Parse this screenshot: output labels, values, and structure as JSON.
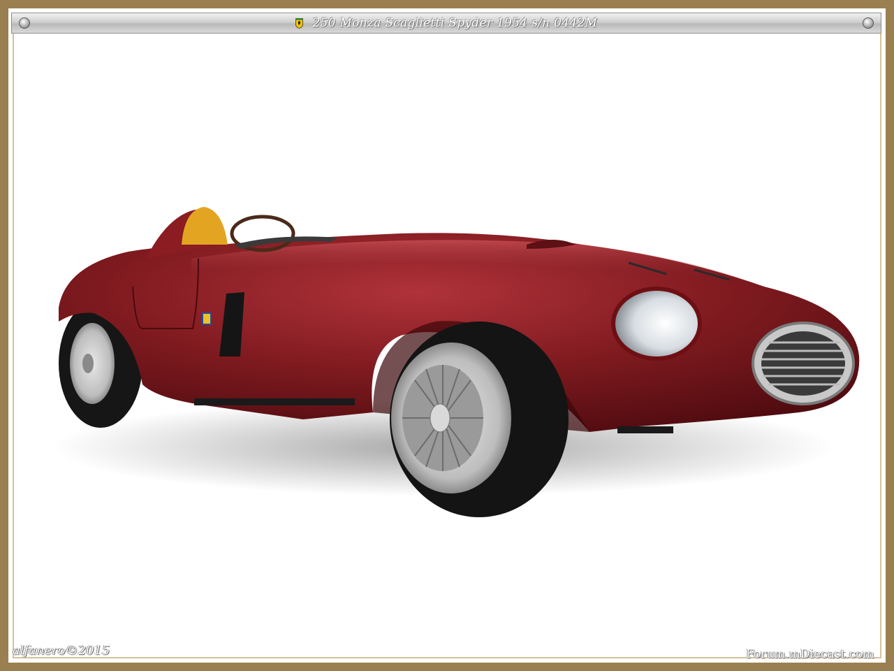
{
  "header": {
    "title": "250 Monza Scaglietti Spyder 1954  s/n 0442M",
    "badge_icon": "prancing-horse-badge-icon"
  },
  "watermarks": {
    "author": "alfanero©2015",
    "site": "Forum.mDiecast.com"
  },
  "photo": {
    "subject": "red-vintage-sports-car",
    "colors": {
      "body": "#7a1418",
      "seat": "#e0a020",
      "frame": "#9a8050",
      "background": "#ffffff"
    }
  }
}
